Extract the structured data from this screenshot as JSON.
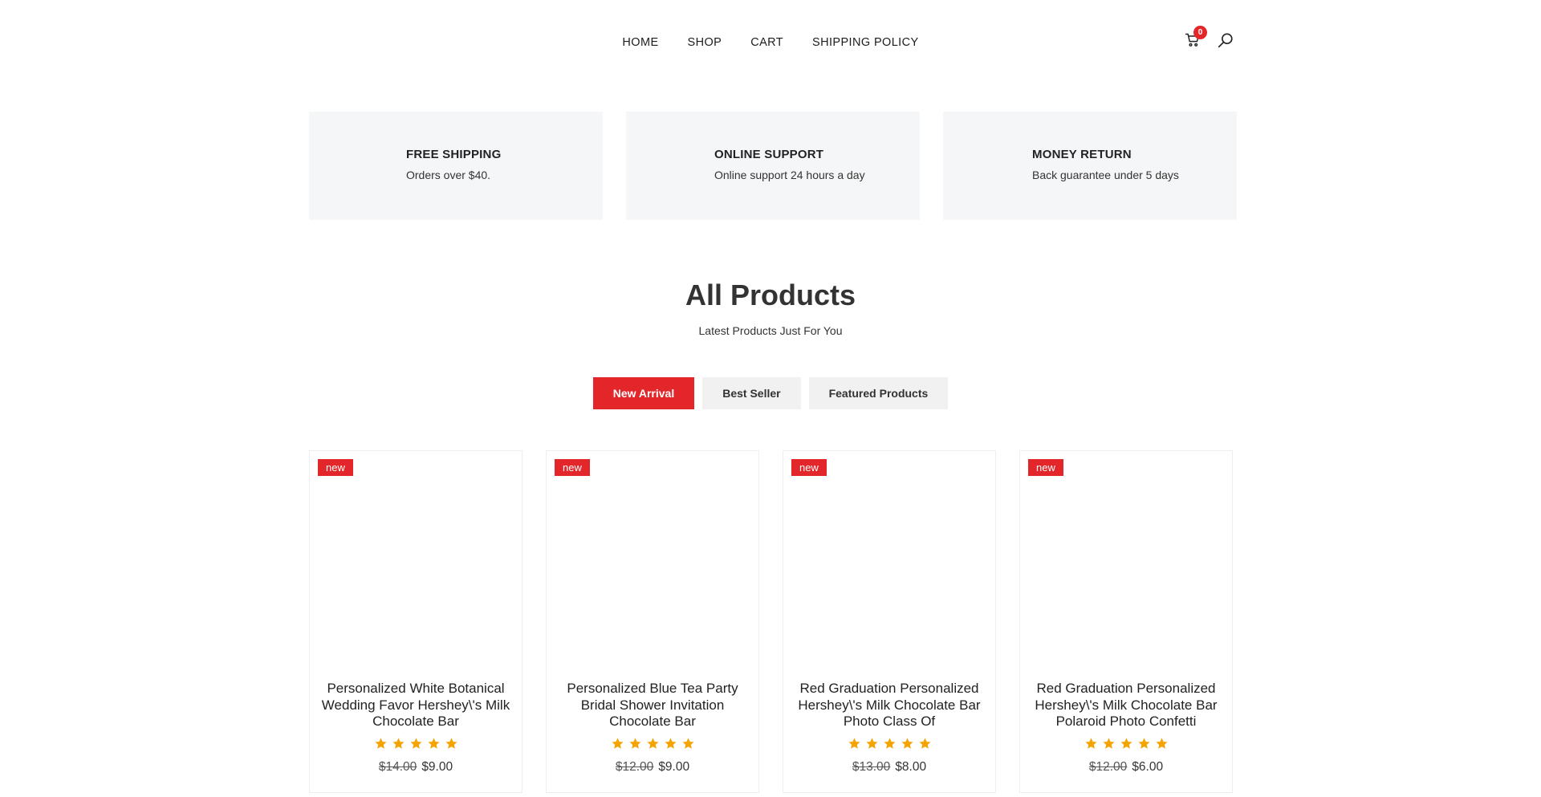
{
  "nav": {
    "items": [
      "HOME",
      "SHOP",
      "CART",
      "SHIPPING POLICY"
    ]
  },
  "header": {
    "cart_count": "0",
    "icons": {
      "cart": "shopping-cart-icon",
      "search": "search-icon"
    }
  },
  "features": [
    {
      "title": "FREE SHIPPING",
      "subtitle": "Orders over $40."
    },
    {
      "title": "ONLINE SUPPORT",
      "subtitle": "Online support 24 hours a day"
    },
    {
      "title": "MONEY RETURN",
      "subtitle": "Back guarantee under 5 days"
    }
  ],
  "section": {
    "title": "All Products",
    "subtitle": "Latest Products Just For You"
  },
  "tabs": [
    {
      "label": "New Arrival",
      "active": true
    },
    {
      "label": "Best Seller",
      "active": false
    },
    {
      "label": "Featured Products",
      "active": false
    }
  ],
  "products": [
    {
      "badge": "new",
      "title": "Personalized White Botanical Wedding Favor Hershey\\'s Milk Chocolate Bar",
      "old_price": "$14.00",
      "price": "$9.00",
      "rating": 5
    },
    {
      "badge": "new",
      "title": "Personalized Blue Tea Party Bridal Shower Invitation Chocolate Bar",
      "old_price": "$12.00",
      "price": "$9.00",
      "rating": 5
    },
    {
      "badge": "new",
      "title": "Red Graduation Personalized Hershey\\'s Milk Chocolate Bar Photo Class Of",
      "old_price": "$13.00",
      "price": "$8.00",
      "rating": 5
    },
    {
      "badge": "new",
      "title": "Red Graduation Personalized Hershey\\'s Milk Chocolate Bar Polaroid Photo Confetti",
      "old_price": "$12.00",
      "price": "$6.00",
      "rating": 5
    }
  ],
  "colors": {
    "accent": "#e3262a",
    "star": "#f4a300",
    "feature_bg": "#f5f6f8",
    "tab_bg": "#f1f1f1"
  }
}
